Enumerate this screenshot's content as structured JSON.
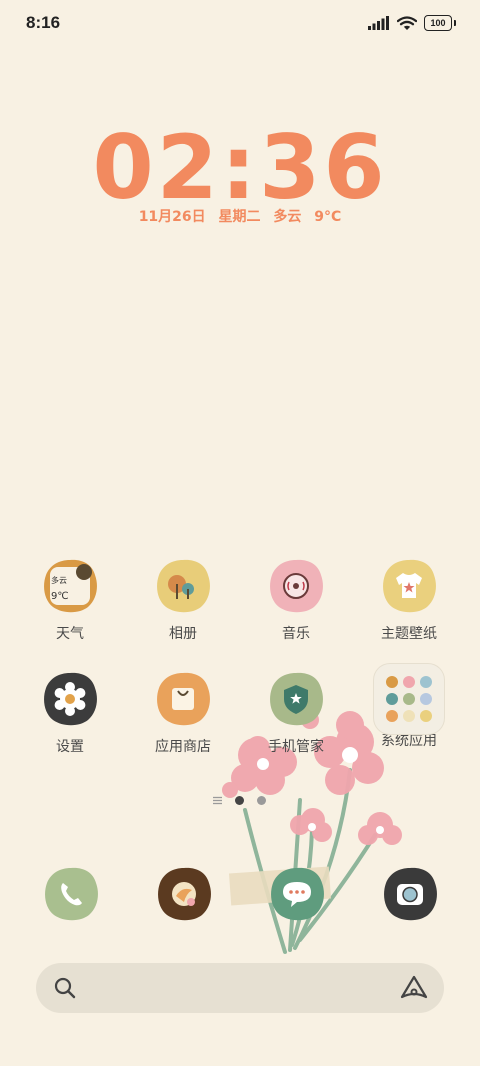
{
  "status_bar": {
    "time": "8:16",
    "battery": "100",
    "icons": [
      "signal-icon",
      "wifi-icon",
      "battery-icon"
    ]
  },
  "clock_widget": {
    "time": "02:36",
    "date": "11月26日  星期二  多云  9°C",
    "color": "#f28a5f"
  },
  "apps": [
    {
      "label": "天气",
      "icon": "weather-icon",
      "color": "#d99a45",
      "widget_text": "多云",
      "widget_temp": "9℃"
    },
    {
      "label": "相册",
      "icon": "gallery-icon",
      "color": "#e8cd79"
    },
    {
      "label": "音乐",
      "icon": "music-icon",
      "color": "#f0b2b8"
    },
    {
      "label": "主题壁纸",
      "icon": "themes-icon",
      "color": "#ead07e"
    },
    {
      "label": "设置",
      "icon": "settings-icon",
      "color": "#3c3c3c"
    },
    {
      "label": "应用商店",
      "icon": "app-store-icon",
      "color": "#e9a25b"
    },
    {
      "label": "手机管家",
      "icon": "security-icon",
      "color": "#a8b98a"
    },
    {
      "label": "系统应用",
      "icon": "system-apps-folder-icon",
      "color": "#f3eee3"
    }
  ],
  "dock": [
    {
      "name": "phone-icon",
      "color": "#a9bf8f"
    },
    {
      "name": "browser-icon",
      "color": "#5b3a20"
    },
    {
      "name": "messages-icon",
      "color": "#5f9c7e"
    },
    {
      "name": "camera-icon",
      "color": "#3a3a3a"
    }
  ],
  "page_indicator": {
    "pages": 2,
    "current": 1
  },
  "search": {
    "icon": "search-icon",
    "assistant": "assistant-icon"
  }
}
